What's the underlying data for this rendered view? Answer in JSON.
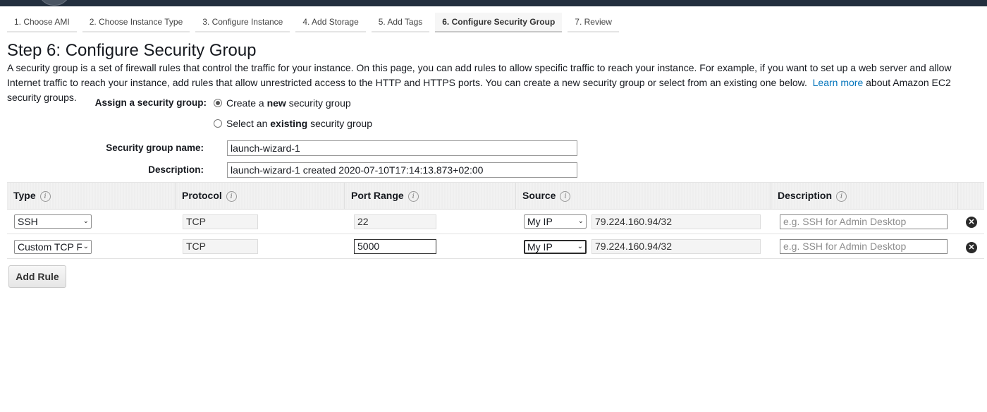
{
  "wizard": {
    "tabs": [
      {
        "label": "1. Choose AMI"
      },
      {
        "label": "2. Choose Instance Type"
      },
      {
        "label": "3. Configure Instance"
      },
      {
        "label": "4. Add Storage"
      },
      {
        "label": "5. Add Tags"
      },
      {
        "label": "6. Configure Security Group",
        "active": true
      },
      {
        "label": "7. Review"
      }
    ]
  },
  "page": {
    "title": "Step 6: Configure Security Group",
    "intro_text": "A security group is a set of firewall rules that control the traffic for your instance. On this page, you can add rules to allow specific traffic to reach your instance. For example, if you want to set up a web server and allow Internet traffic to reach your instance, add rules that allow unrestricted access to the HTTP and HTTPS ports. You can create a new security group or select from an existing one below.",
    "learn_more": "Learn more",
    "intro_suffix": "about Amazon EC2 security groups."
  },
  "assign": {
    "label": "Assign a security group:",
    "option_create_prefix": "Create a",
    "option_create_bold": "new",
    "option_create_suffix": "security group",
    "option_select_prefix": "Select an",
    "option_select_bold": "existing",
    "option_select_suffix": "security group",
    "selected": "create"
  },
  "group": {
    "name_label": "Security group name:",
    "name_value": "launch-wizard-1",
    "description_label": "Description:",
    "description_value": "launch-wizard-1 created 2020-07-10T17:14:13.873+02:00"
  },
  "rules_table": {
    "columns": [
      "Type",
      "Protocol",
      "Port Range",
      "Source",
      "Description"
    ],
    "info_glyph": "i",
    "rows": [
      {
        "type": "SSH",
        "protocol": "TCP",
        "port_range": "22",
        "source_type": "My IP",
        "source_cidr": "79.224.160.94/32",
        "description_placeholder": "e.g. SSH for Admin Desktop"
      },
      {
        "type": "Custom TCP F",
        "protocol": "TCP",
        "port_range": "5000",
        "source_type": "My IP",
        "source_cidr": "79.224.160.94/32",
        "description_placeholder": "e.g. SSH for Admin Desktop"
      }
    ],
    "remove_glyph": "✕",
    "chevron_glyph": "⌄"
  },
  "actions": {
    "add_rule": "Add Rule"
  }
}
